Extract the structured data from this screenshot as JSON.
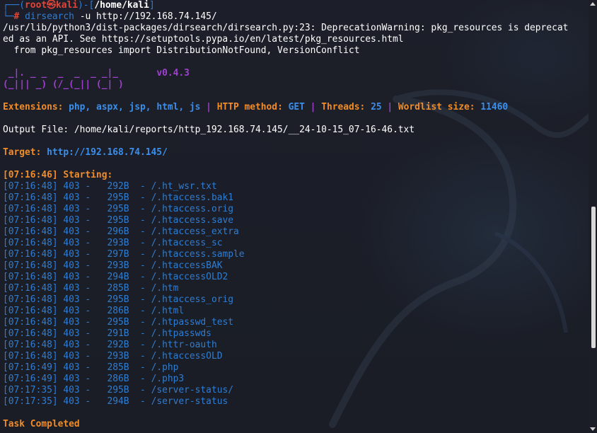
{
  "prompt": {
    "corner_top": "┌──(",
    "user": "root",
    "at": "㉿",
    "host": "kali",
    "mid": ")-[",
    "path": "/home/kali",
    "end": "]",
    "corner_bottom": "└─",
    "hash": "#",
    "command": "dirsearch",
    "args": "-u http://192.168.74.145/"
  },
  "warning_lines": [
    "/usr/lib/python3/dist-packages/dirsearch/dirsearch.py:23: DeprecationWarning: pkg_resources is deprecat",
    "ed as an API. See https://setuptools.pypa.io/en/latest/pkg_resources.html",
    "  from pkg_resources import DistributionNotFound, VersionConflict"
  ],
  "banner": {
    "art_line1": " _|. _ _  _  _  _ _|_",
    "art_line2": "(_||| _) (/_(_|| (_| )",
    "version": "v0.4.3"
  },
  "config": {
    "extensions_label": "Extensions:",
    "extensions_value": "php, aspx, jsp, html, js",
    "sep": "|",
    "method_label": "HTTP method:",
    "method_value": "GET",
    "threads_label": "Threads:",
    "threads_value": "25",
    "wordlist_label": "Wordlist size:",
    "wordlist_value": "11460"
  },
  "output_file": "Output File: /home/kali/reports/http_192.168.74.145/__24-10-15_07-16-46.txt",
  "target": {
    "label": "Target:",
    "url": "http://192.168.74.145/"
  },
  "starting": "[07:16:46] Starting:",
  "results": [
    {
      "time": "[07:16:48]",
      "status": "403",
      "size": "292B",
      "path": "/.ht_wsr.txt"
    },
    {
      "time": "[07:16:48]",
      "status": "403",
      "size": "295B",
      "path": "/.htaccess.bak1"
    },
    {
      "time": "[07:16:48]",
      "status": "403",
      "size": "295B",
      "path": "/.htaccess.orig"
    },
    {
      "time": "[07:16:48]",
      "status": "403",
      "size": "295B",
      "path": "/.htaccess.save"
    },
    {
      "time": "[07:16:48]",
      "status": "403",
      "size": "296B",
      "path": "/.htaccess_extra"
    },
    {
      "time": "[07:16:48]",
      "status": "403",
      "size": "293B",
      "path": "/.htaccess_sc"
    },
    {
      "time": "[07:16:48]",
      "status": "403",
      "size": "297B",
      "path": "/.htaccess.sample"
    },
    {
      "time": "[07:16:48]",
      "status": "403",
      "size": "293B",
      "path": "/.htaccessBAK"
    },
    {
      "time": "[07:16:48]",
      "status": "403",
      "size": "294B",
      "path": "/.htaccessOLD2"
    },
    {
      "time": "[07:16:48]",
      "status": "403",
      "size": "285B",
      "path": "/.htm"
    },
    {
      "time": "[07:16:48]",
      "status": "403",
      "size": "295B",
      "path": "/.htaccess_orig"
    },
    {
      "time": "[07:16:48]",
      "status": "403",
      "size": "286B",
      "path": "/.html"
    },
    {
      "time": "[07:16:48]",
      "status": "403",
      "size": "295B",
      "path": "/.htpasswd_test"
    },
    {
      "time": "[07:16:48]",
      "status": "403",
      "size": "291B",
      "path": "/.htpasswds"
    },
    {
      "time": "[07:16:48]",
      "status": "403",
      "size": "292B",
      "path": "/.httr-oauth"
    },
    {
      "time": "[07:16:48]",
      "status": "403",
      "size": "293B",
      "path": "/.htaccessOLD"
    },
    {
      "time": "[07:16:49]",
      "status": "403",
      "size": "285B",
      "path": "/.php"
    },
    {
      "time": "[07:16:49]",
      "status": "403",
      "size": "286B",
      "path": "/.php3"
    },
    {
      "time": "[07:17:35]",
      "status": "403",
      "size": "295B",
      "path": "/server-status/"
    },
    {
      "time": "[07:17:35]",
      "status": "403",
      "size": "294B",
      "path": "/server-status"
    }
  ],
  "completed": "Task Completed",
  "colors": {
    "background": "#1b1e27",
    "prompt_blue": "#2f7dd2",
    "root_red": "#e0453a",
    "orange": "#f08c2a",
    "purple": "#a040d0",
    "value_blue": "#3b8eea"
  }
}
